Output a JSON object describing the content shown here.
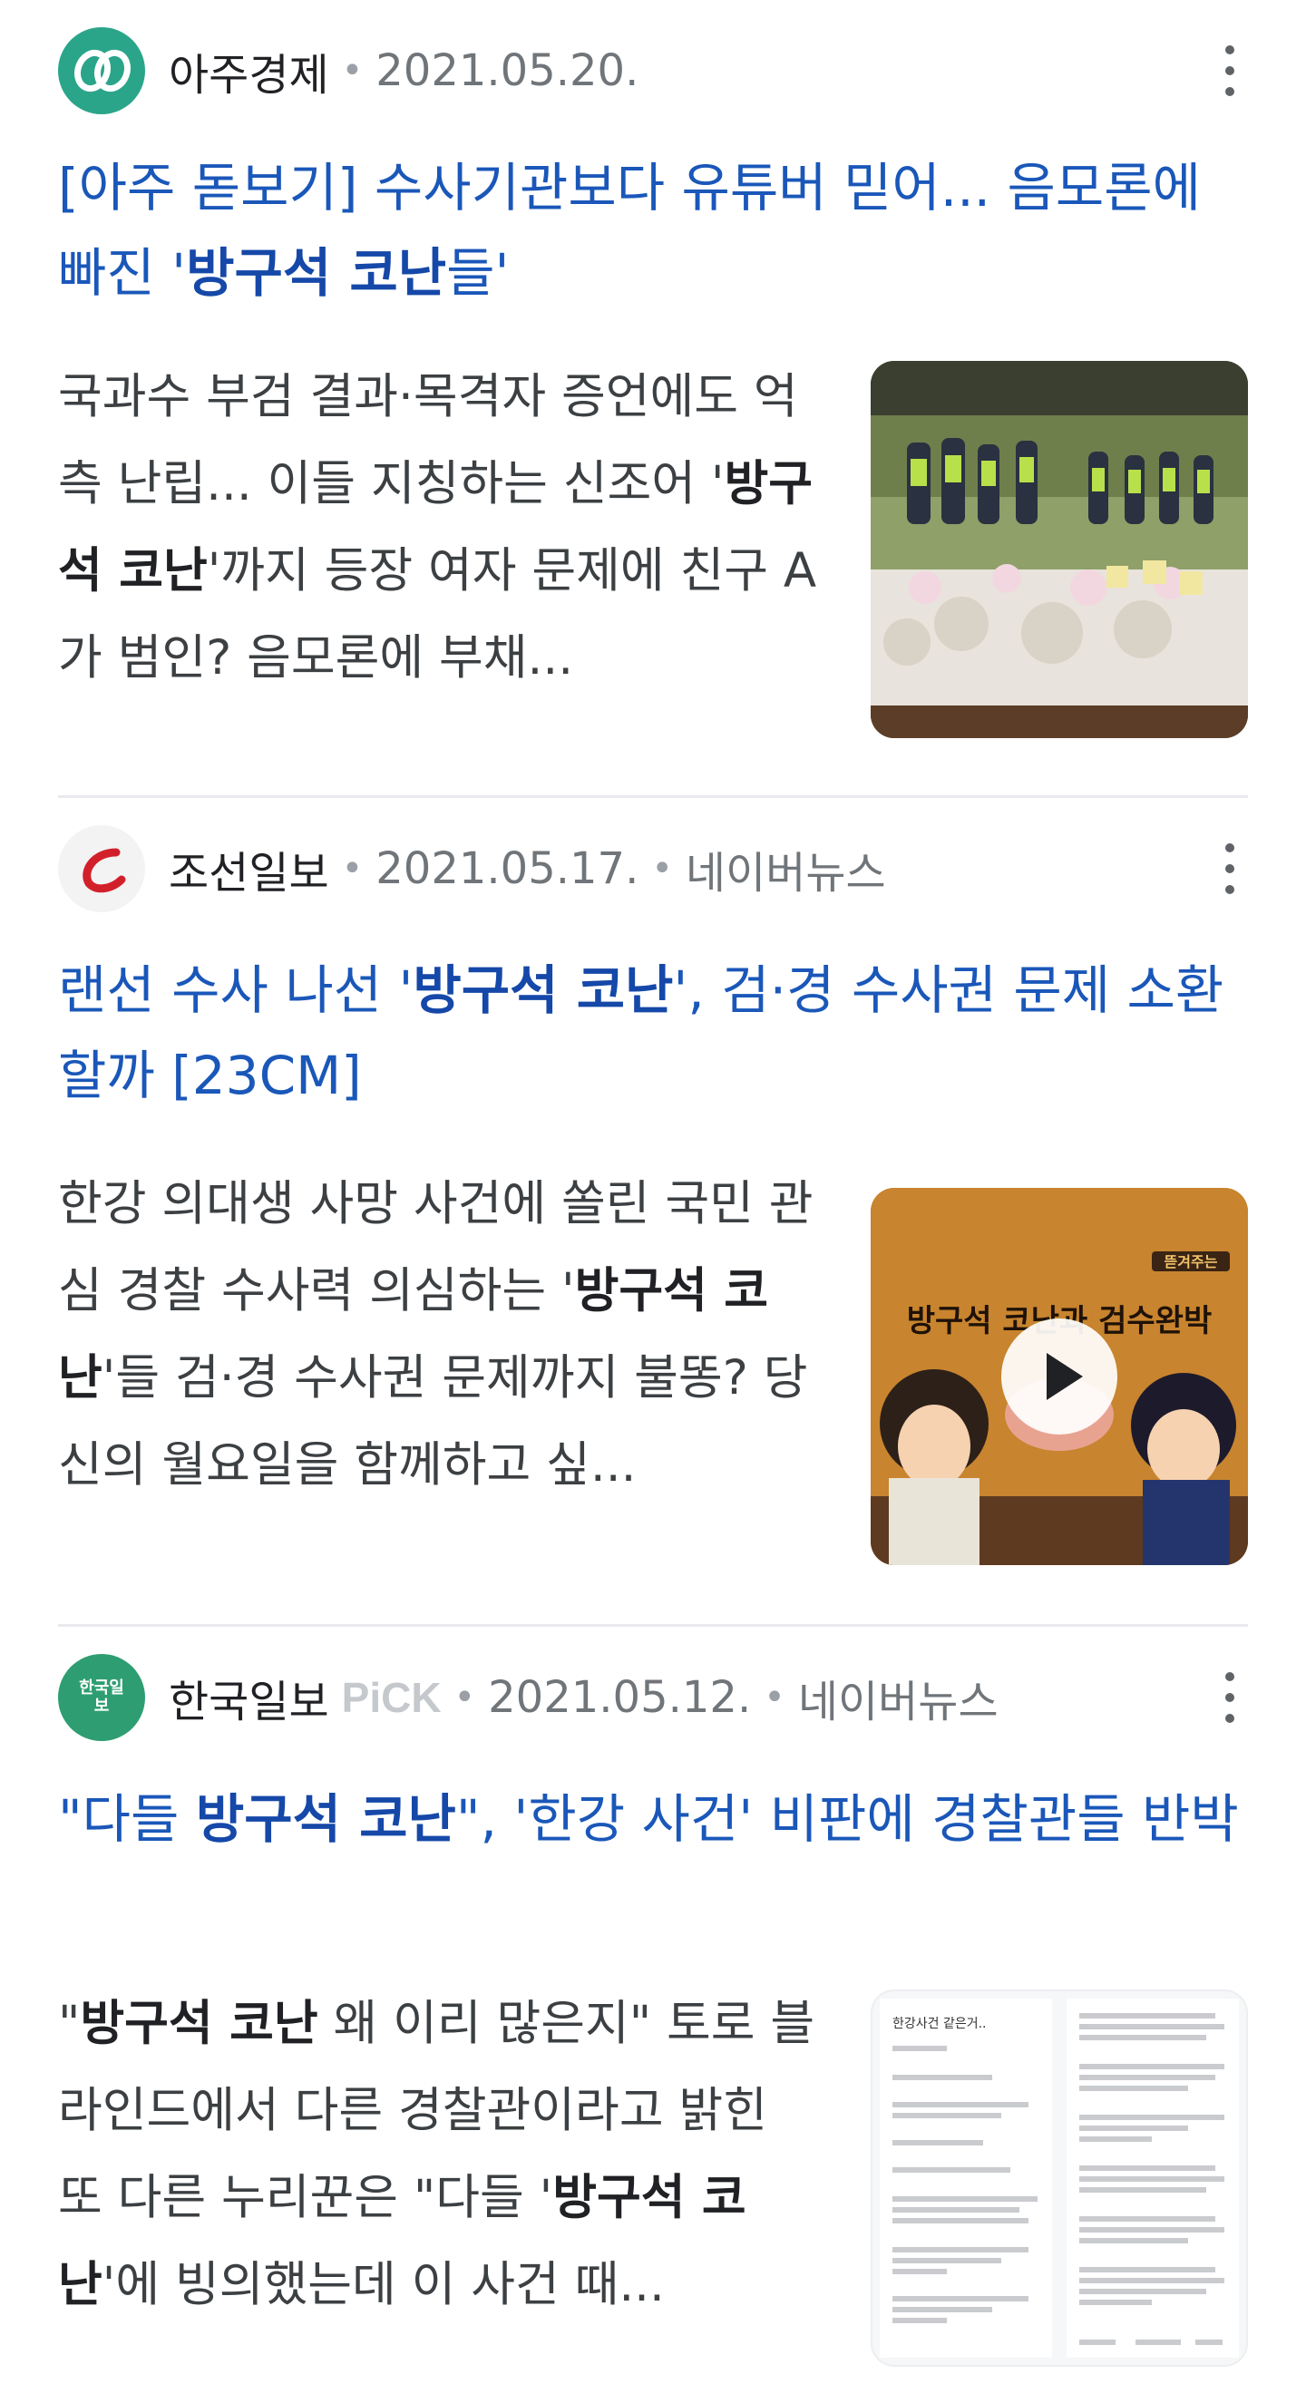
{
  "articles": [
    {
      "source": "아주경제",
      "date": "2021.05.20.",
      "title_parts": [
        "[아주 돋보기] 수사기관보다 유튜버 믿어... 음모론에 빠진 '",
        "방구석 코난",
        "들'"
      ],
      "snippet_parts": [
        "국과수 부검 결과·목격자 증언에도 억측 난립... 이들 지칭하는 신조어 '",
        "방구석 코난",
        "'까지 등장 여자 문제에 친구 A가 범인? 음모론에 부채..."
      ],
      "thumb_type": "photo"
    },
    {
      "source": "조선일보",
      "date": "2021.05.17.",
      "platform": "네이버뉴스",
      "title_parts": [
        "랜선 수사 나선 '",
        "방구석 코난",
        "', 검·경 수사권 문제 소환할까 [23CM]"
      ],
      "snippet_parts": [
        "한강 의대생 사망 사건에 쏠린 국민 관심 경찰 수사력 의심하는 '",
        "방구석 코난",
        "'들 검·경 수사권 문제까지 불똥? 당신의 월요일을 함께하고 싶..."
      ],
      "thumb_type": "video",
      "thumb_title": "방구석 코난과 검수완박",
      "thumb_badge": "뜯겨주는"
    },
    {
      "source": "한국일보",
      "pick": "PiCK",
      "logo_text": "한국일보",
      "date": "2021.05.12.",
      "platform": "네이버뉴스",
      "title_parts": [
        "\"다들 ",
        "방구석 코난",
        "\", '한강 사건' 비판에 경찰관들 반박"
      ],
      "snippet_parts": [
        "\"",
        "방구석 코난",
        " 왜 이리 많은지\" 토로 블라인드에서 다른 경찰관이라고 밝힌 또 다른 누리꾼은 \"다들 '",
        "방구석 코난",
        "'에 빙의했는데 이 사건 때..."
      ],
      "thumb_type": "document",
      "thumb_heading": "한강사건 같은거.."
    }
  ],
  "colors": {
    "title_blue": "#1a57b9",
    "ajou_logo": "#2aa58a",
    "chosun_red": "#d2202b",
    "hankook_green": "#2e9e72"
  },
  "icons": {
    "more": "vertical-ellipsis-icon",
    "play": "play-icon"
  }
}
